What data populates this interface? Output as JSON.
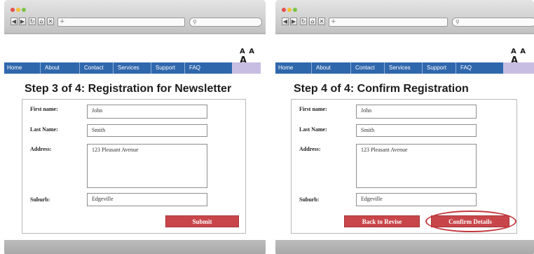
{
  "left": {
    "text_size_controls": [
      "A",
      "A",
      "A"
    ],
    "menu": [
      "Home",
      "About",
      "Contact",
      "Services",
      "Support",
      "FAQ"
    ],
    "title": "Step 3 of 4: Registration for Newsletter",
    "fields": {
      "first_name": {
        "label": "First name:",
        "value": "John"
      },
      "last_name": {
        "label": "Last Name:",
        "value": "Smith"
      },
      "address": {
        "label": "Address:",
        "value": "123 Pleasant Avenue"
      },
      "suburb": {
        "label": "Suburb:",
        "value": "Edgeville"
      }
    },
    "submit_label": "Submit"
  },
  "right": {
    "text_size_controls": [
      "A",
      "A",
      "A"
    ],
    "menu": [
      "Home",
      "About",
      "Contact",
      "Services",
      "Support",
      "FAQ"
    ],
    "title": "Step 4 of 4: Confirm Registration",
    "fields": {
      "first_name": {
        "label": "First name:",
        "value": "John"
      },
      "last_name": {
        "label": "Last Name:",
        "value": "Smith"
      },
      "address": {
        "label": "Address:",
        "value": "123 Pleasant Avenue"
      },
      "suburb": {
        "label": "Suburb:",
        "value": "Edgeville"
      }
    },
    "back_label": "Back to Revise",
    "confirm_label": "Confirm Details"
  },
  "colors": {
    "menu_blue": "#2f67ad",
    "menu_lavender": "#c7bde2",
    "button_red": "#c8464a",
    "highlight_red": "#c5393e"
  },
  "icons": [
    "close-dot",
    "minimize-dot",
    "zoom-dot",
    "back-arrow-icon",
    "forward-arrow-icon",
    "refresh-icon",
    "home-icon",
    "stop-icon",
    "add-tab-icon",
    "search-icon"
  ]
}
